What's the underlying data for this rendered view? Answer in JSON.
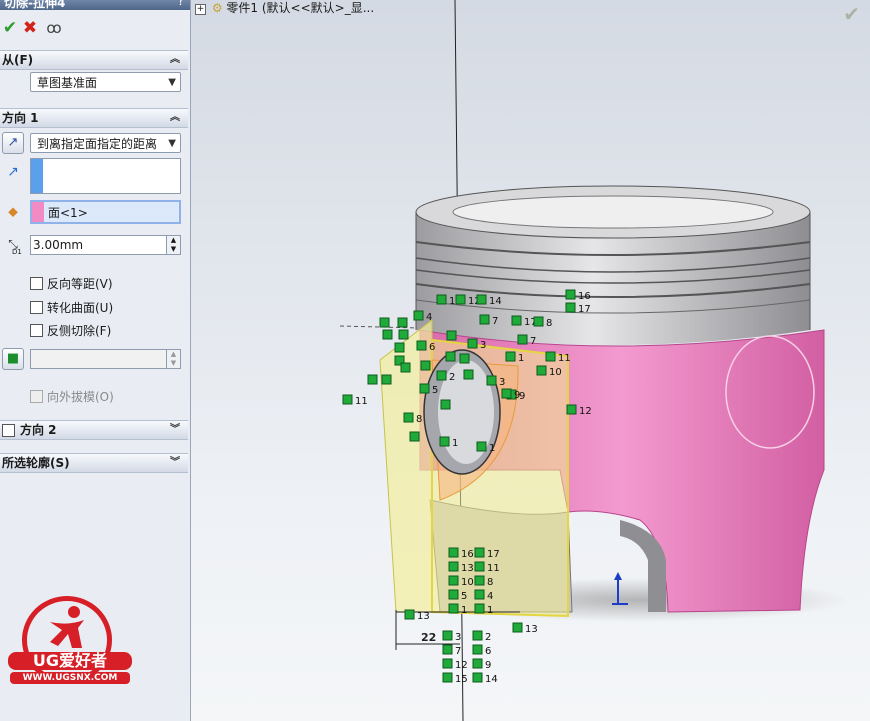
{
  "feature": {
    "title": "切除-拉伸4",
    "help_label": "?"
  },
  "actions": {
    "ok_icon": "check-icon",
    "cancel_icon": "x-icon",
    "preview_icon": "glasses-icon"
  },
  "from": {
    "header": "从(F)",
    "selected": "草图基准面"
  },
  "direction1": {
    "header": "方向 1",
    "end_condition": "到离指定面指定的距离",
    "direction_box": "",
    "face_box": "面<1>",
    "distance": "3.00mm",
    "distance_icon_label": "D1",
    "reverse_offset": "反向等距(V)",
    "translate_surface": "转化曲面(U)",
    "flip_side": "反侧切除(F)",
    "draft_outward": "向外拔模(O)"
  },
  "direction2": {
    "header": "方向 2"
  },
  "selected_contours": {
    "header": "所选轮廓(S)"
  },
  "tree": {
    "root": "零件1 (默认<<默认>_显..."
  },
  "logo": {
    "brand": "UG爱好者",
    "site": "WWW.UGSNX.COM"
  },
  "colors": {
    "face_pink": "#e879b9",
    "sketch_yellow": "#f2ee9c",
    "relation_green": "#1faa3a",
    "piston_gray": "#c7c7c9",
    "accent_blue": "#5aa0ea"
  },
  "dimension": "22",
  "relation_labels": {
    "top": [
      "16",
      "12",
      "14",
      "16",
      "17",
      "7",
      "17",
      "8",
      "7",
      "11",
      "10",
      "3",
      "9",
      "12",
      "11",
      "1",
      "1",
      "3",
      "4",
      "2",
      "6",
      "9",
      "1",
      "5",
      "8"
    ],
    "column_left": [
      "16",
      "13",
      "10",
      "5",
      "1",
      "3",
      "7",
      "12",
      "15"
    ],
    "column_right": [
      "17",
      "11",
      "8",
      "4",
      "1",
      "2",
      "6",
      "9",
      "14"
    ],
    "bottom_side": [
      "13",
      "13"
    ]
  }
}
